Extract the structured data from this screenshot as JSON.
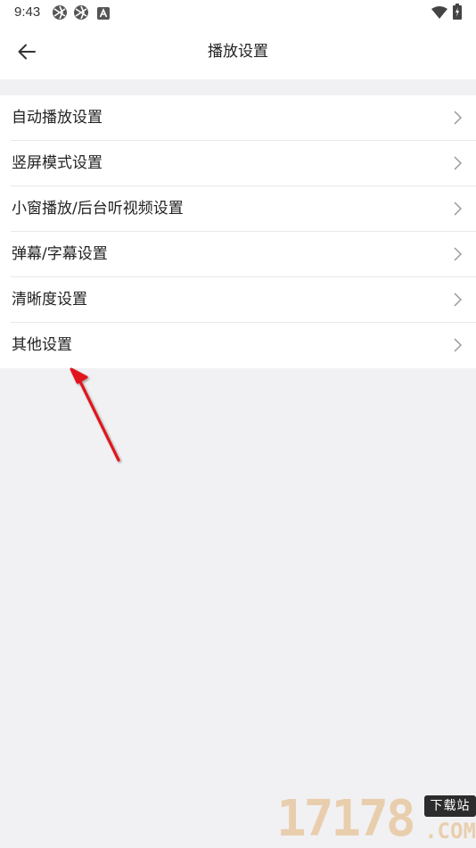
{
  "status_bar": {
    "time": "9:43",
    "icons_left": [
      "aperture-icon",
      "aperture-icon",
      "a-badge-icon"
    ],
    "icons_right": [
      "wifi-icon",
      "battery-icon"
    ]
  },
  "toolbar": {
    "back_icon": "arrow-left-icon",
    "title": "播放设置"
  },
  "menu": {
    "items": [
      {
        "label": "自动播放设置"
      },
      {
        "label": "竖屏模式设置"
      },
      {
        "label": "小窗播放/后台听视频设置"
      },
      {
        "label": "弹幕/字幕设置"
      },
      {
        "label": "清晰度设置"
      },
      {
        "label": "其他设置"
      }
    ]
  },
  "annotation": {
    "color": "#e0151b"
  },
  "watermark": {
    "number": "17178",
    "badge": "下载站",
    "domain": ".COM"
  },
  "colors": {
    "background": "#f1f1f3",
    "surface": "#ffffff",
    "text": "#222222",
    "chevron": "#9a9a9a"
  }
}
